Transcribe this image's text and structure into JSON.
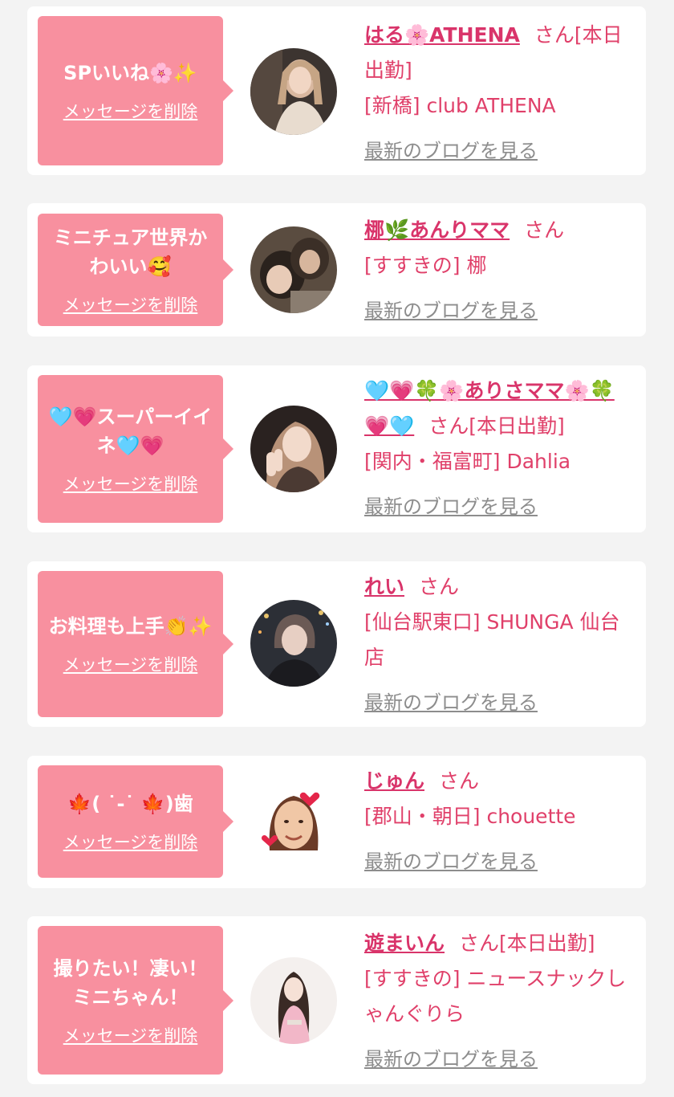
{
  "colors": {
    "background": "#f3f3f3",
    "card": "#ffffff",
    "bubble": "#f8909f",
    "accent": "#e0406a",
    "link_gray": "#8d8d8d"
  },
  "labels": {
    "delete": "メッセージを削除",
    "blog": "最新のブログを見る",
    "san": "さん"
  },
  "items": [
    {
      "message": "SPいいね🌸✨",
      "name": "はる🌸ATHENA",
      "san_suffix": "さん[本日出勤]",
      "shop": "[新橋] club ATHENA",
      "avatar_icon": "woman-photo-avatar"
    },
    {
      "message": "ミニチュア世界かわいい🥰",
      "name": "梛🌿あんりママ",
      "san_suffix": "さん",
      "shop": "[すすきの] 梛",
      "avatar_icon": "couple-photo-avatar"
    },
    {
      "message": "🩵💗スーパーイイネ🩵💗",
      "name": "🩵💗🍀🌸ありさママ🌸🍀💗🩵",
      "san_suffix": "さん[本日出勤]",
      "shop": "[関内・福富町] Dahlia",
      "avatar_icon": "peace-sign-photo-avatar"
    },
    {
      "message": "お料理も上手👏✨",
      "name": "れい",
      "san_suffix": "さん",
      "shop": "[仙台駅東口] SHUNGA 仙台店",
      "avatar_icon": "night-photo-avatar"
    },
    {
      "message": "🍁( ˙-˙ 🍁)歯",
      "name": "じゅん",
      "san_suffix": "さん",
      "shop": "[郡山・朝日] chouette",
      "avatar_icon": "memoji-avatar"
    },
    {
      "message": "撮りたい！凄い！ミニちゃん！",
      "name": "遊まいん",
      "san_suffix": "さん[本日出勤]",
      "shop": "[すすきの] ニュースナックしゃんぐりら",
      "avatar_icon": "kimono-photo-avatar"
    }
  ]
}
